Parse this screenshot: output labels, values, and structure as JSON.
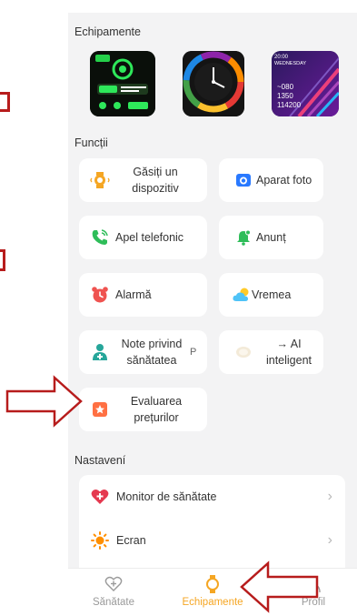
{
  "sections": {
    "equipment": "Echipamente",
    "functions": "Funcții",
    "settings": "Nastavení"
  },
  "watchface3": {
    "time": "20:00",
    "day": "WEDNESDAY",
    "lines": [
      "~080",
      "1350",
      "114200"
    ]
  },
  "functions": [
    {
      "id": "find-device",
      "label": "Găsiți un dispozitiv",
      "icon": "watch-search-icon"
    },
    {
      "id": "camera",
      "label": "Aparat foto",
      "icon": "camera-icon"
    },
    {
      "id": "phone-call",
      "label": "Apel telefonic",
      "icon": "phone-icon"
    },
    {
      "id": "notice",
      "label": "Anunț",
      "icon": "bell-icon"
    },
    {
      "id": "alarm",
      "label": "Alarmă",
      "icon": "alarm-clock-icon"
    },
    {
      "id": "weather",
      "label": "Vremea",
      "icon": "weather-icon"
    },
    {
      "id": "health-notes",
      "label": "Note privind sănătatea",
      "icon": "health-notes-icon",
      "trail": "P"
    },
    {
      "id": "ai",
      "label": "→ AI inteligent",
      "icon": "ai-icon"
    },
    {
      "id": "rate",
      "label": "Evaluarea prețurilor",
      "icon": "rating-icon"
    }
  ],
  "settings_items": [
    {
      "id": "health-monitor",
      "label": "Monitor de sănătate",
      "icon": "heart-plus-icon"
    },
    {
      "id": "screen",
      "label": "Ecran",
      "icon": "brightness-icon"
    }
  ],
  "tabs": [
    {
      "id": "health",
      "label": "Sănătate",
      "active": false
    },
    {
      "id": "devices",
      "label": "Echipamente",
      "active": true
    },
    {
      "id": "profile",
      "label": "Profil",
      "active": false
    }
  ],
  "colors": {
    "accent": "#f5a623",
    "annotation": "#b71c1c",
    "background": "#f3f3f4"
  }
}
